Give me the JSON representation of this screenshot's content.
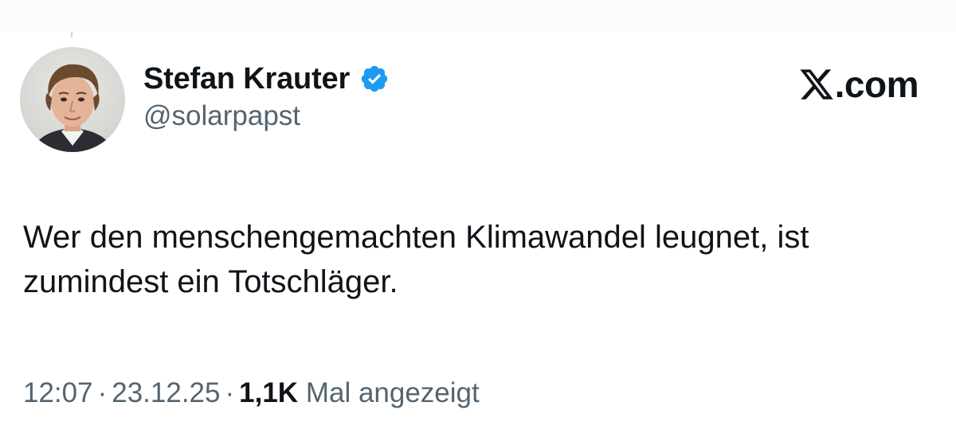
{
  "tweet": {
    "author": {
      "display_name": "Stefan Krauter",
      "handle": "@solarpapst",
      "verified": true,
      "avatar_icon": "profile-photo"
    },
    "brand": {
      "logo_icon": "x-logo-icon",
      "domain": ".com"
    },
    "text": "Wer den menschengemachten Klimawandel leugnet, ist zumindest ein Totschläger.",
    "meta": {
      "time": "12:07",
      "separator": "·",
      "date": "23.12.25",
      "views_count": "1,1K",
      "views_label": "Mal angezeigt"
    }
  },
  "colors": {
    "text_primary": "#0f1419",
    "text_secondary": "#536471",
    "verified_blue": "#1d9bf0",
    "background": "#ffffff"
  }
}
